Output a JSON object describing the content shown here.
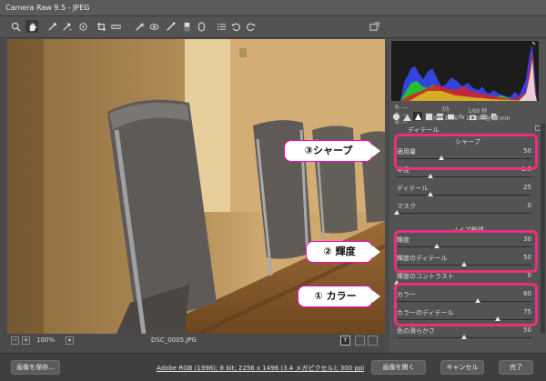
{
  "window": {
    "title": "Camera Raw 9.5  -  JPEG"
  },
  "toolbar": {
    "tools": [
      "zoom-icon",
      "hand-icon",
      "white-balance-icon",
      "color-sampler-icon",
      "target-adjust-icon",
      "crop-icon",
      "straighten-icon",
      "spot-removal-icon",
      "red-eye-icon",
      "adjustment-brush-icon",
      "graduated-filter-icon",
      "radial-filter-icon",
      "presets-list-icon",
      "rotate-ccw-icon",
      "rotate-cw-icon"
    ],
    "fullscreen_icon": "fullscreen-icon"
  },
  "status": {
    "zoom": "100%",
    "filename": "DSC_0005.JPG",
    "y_label": "Y"
  },
  "info": {
    "r": "R:",
    "g": "G:",
    "b": "B:",
    "r_val": "---",
    "g_val": "---",
    "b_val": "---",
    "aperture": "f/5",
    "shutter": "1/60 秒",
    "iso": "ISO 1600",
    "lens": "18-200@18 mm"
  },
  "panel": {
    "section_detail": "ディテール",
    "sharpen_head": "シャープ",
    "sliders_sharpen": [
      {
        "label": "適用量",
        "value": "50",
        "pos": 0.33
      },
      {
        "label": "半径",
        "value": "1.0",
        "pos": 0.25
      },
      {
        "label": "ディテール",
        "value": "25",
        "pos": 0.25
      },
      {
        "label": "マスク",
        "value": "0",
        "pos": 0.0
      }
    ],
    "noise_head": "ノイズ軽減",
    "sliders_noise": [
      {
        "label": "輝度",
        "value": "30",
        "pos": 0.3
      },
      {
        "label": "輝度のディテール",
        "value": "50",
        "pos": 0.5
      },
      {
        "label": "輝度のコントラスト",
        "value": "0",
        "pos": 0.0
      },
      {
        "label": "カラー",
        "value": "60",
        "pos": 0.6
      },
      {
        "label": "カラーのディテール",
        "value": "75",
        "pos": 0.75
      },
      {
        "label": "色の滑らかさ",
        "value": "50",
        "pos": 0.5
      }
    ]
  },
  "callouts": {
    "sharpen": "③シャープ",
    "luminance": "② 輝度",
    "color": "① カラー"
  },
  "bottom": {
    "save": "画像を保存...",
    "workflow_link": "Adobe RGB (1998); 8 bit; 2256 x 1496 (3.4 メガピクセル); 300 ppi",
    "open": "画像を開く",
    "cancel": "キャンセル",
    "done": "完了"
  },
  "colors": {
    "highlight": "#e8317a",
    "panel": "#535353",
    "histogram_bg": "#1c1c1c"
  }
}
